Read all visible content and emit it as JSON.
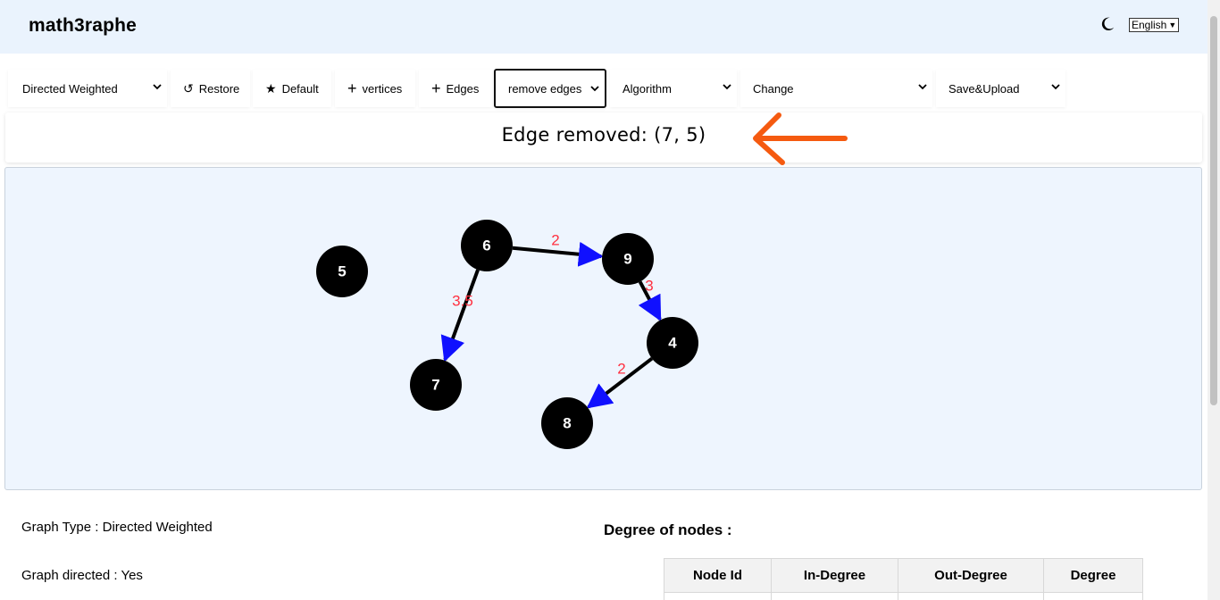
{
  "header": {
    "brand": "math3raphe",
    "language": "English"
  },
  "toolbar": {
    "graph_type": "Directed Weighted",
    "restore": "Restore",
    "default": "Default",
    "vertices": "vertices",
    "edges": "Edges",
    "remove_edges": "remove edges",
    "algorithm": "Algorithm",
    "change": "Change",
    "save_upload": "Save&Upload"
  },
  "status": {
    "message": "Edge removed: (7, 5)"
  },
  "graph": {
    "node_color": "#000000",
    "edge_color": "#000000",
    "arrow_color": "#1010ff",
    "weight_color": "#ff3040",
    "nodes": [
      {
        "id": "5"
      },
      {
        "id": "6"
      },
      {
        "id": "9"
      },
      {
        "id": "4"
      },
      {
        "id": "7"
      },
      {
        "id": "8"
      }
    ],
    "edges": [
      {
        "from": "6",
        "to": "9",
        "weight": "2"
      },
      {
        "from": "6",
        "to": "7",
        "weight": "3.5"
      },
      {
        "from": "9",
        "to": "4",
        "weight": "3"
      },
      {
        "from": "4",
        "to": "8",
        "weight": "2"
      }
    ]
  },
  "info": {
    "graph_type_label": "Graph Type : Directed Weighted",
    "graph_directed_label": "Graph directed : Yes",
    "degree_title": "Degree of nodes :",
    "table_headers": [
      "Node Id",
      "In-Degree",
      "Out-Degree",
      "Degree"
    ]
  }
}
